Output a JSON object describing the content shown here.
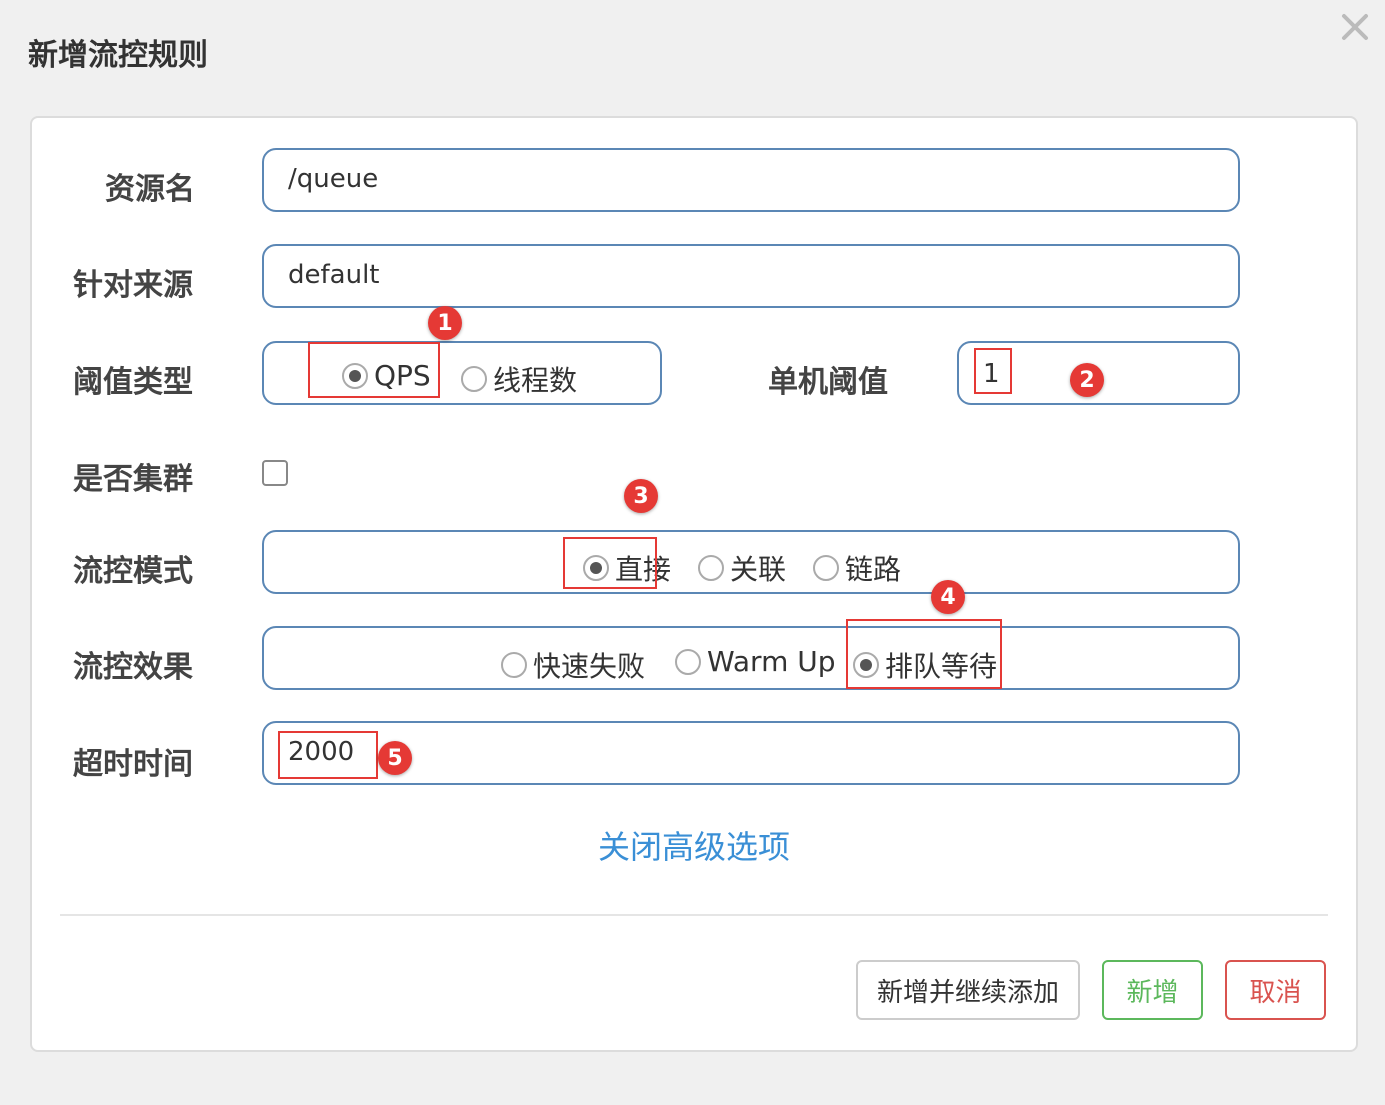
{
  "dialog": {
    "title": "新增流控规则"
  },
  "form": {
    "resource_label": "资源名",
    "resource_value": "/queue",
    "source_label": "针对来源",
    "source_value": "default",
    "threshold_type_label": "阈值类型",
    "threshold_type_options": [
      "QPS",
      "线程数"
    ],
    "threshold_type_selected": "QPS",
    "single_threshold_label": "单机阈值",
    "single_threshold_value": "1",
    "cluster_label": "是否集群",
    "cluster_checked": false,
    "flow_mode_label": "流控模式",
    "flow_mode_options": [
      "直接",
      "关联",
      "链路"
    ],
    "flow_mode_selected": "直接",
    "flow_effect_label": "流控效果",
    "flow_effect_options": [
      "快速失败",
      "Warm Up",
      "排队等待"
    ],
    "flow_effect_selected": "排队等待",
    "timeout_label": "超时时间",
    "timeout_value": "2000",
    "advanced_toggle": "关闭高级选项"
  },
  "annotations": [
    "1",
    "2",
    "3",
    "4",
    "5"
  ],
  "buttons": {
    "continue_label": "新增并继续添加",
    "add_label": "新增",
    "cancel_label": "取消"
  },
  "colors": {
    "annotation_red": "#e53935",
    "field_border": "#5b87b5",
    "link_blue": "#3a8fd6",
    "add_green": "#5cb85c",
    "cancel_red": "#d9534f"
  },
  "icons": {
    "close": "close-icon"
  }
}
